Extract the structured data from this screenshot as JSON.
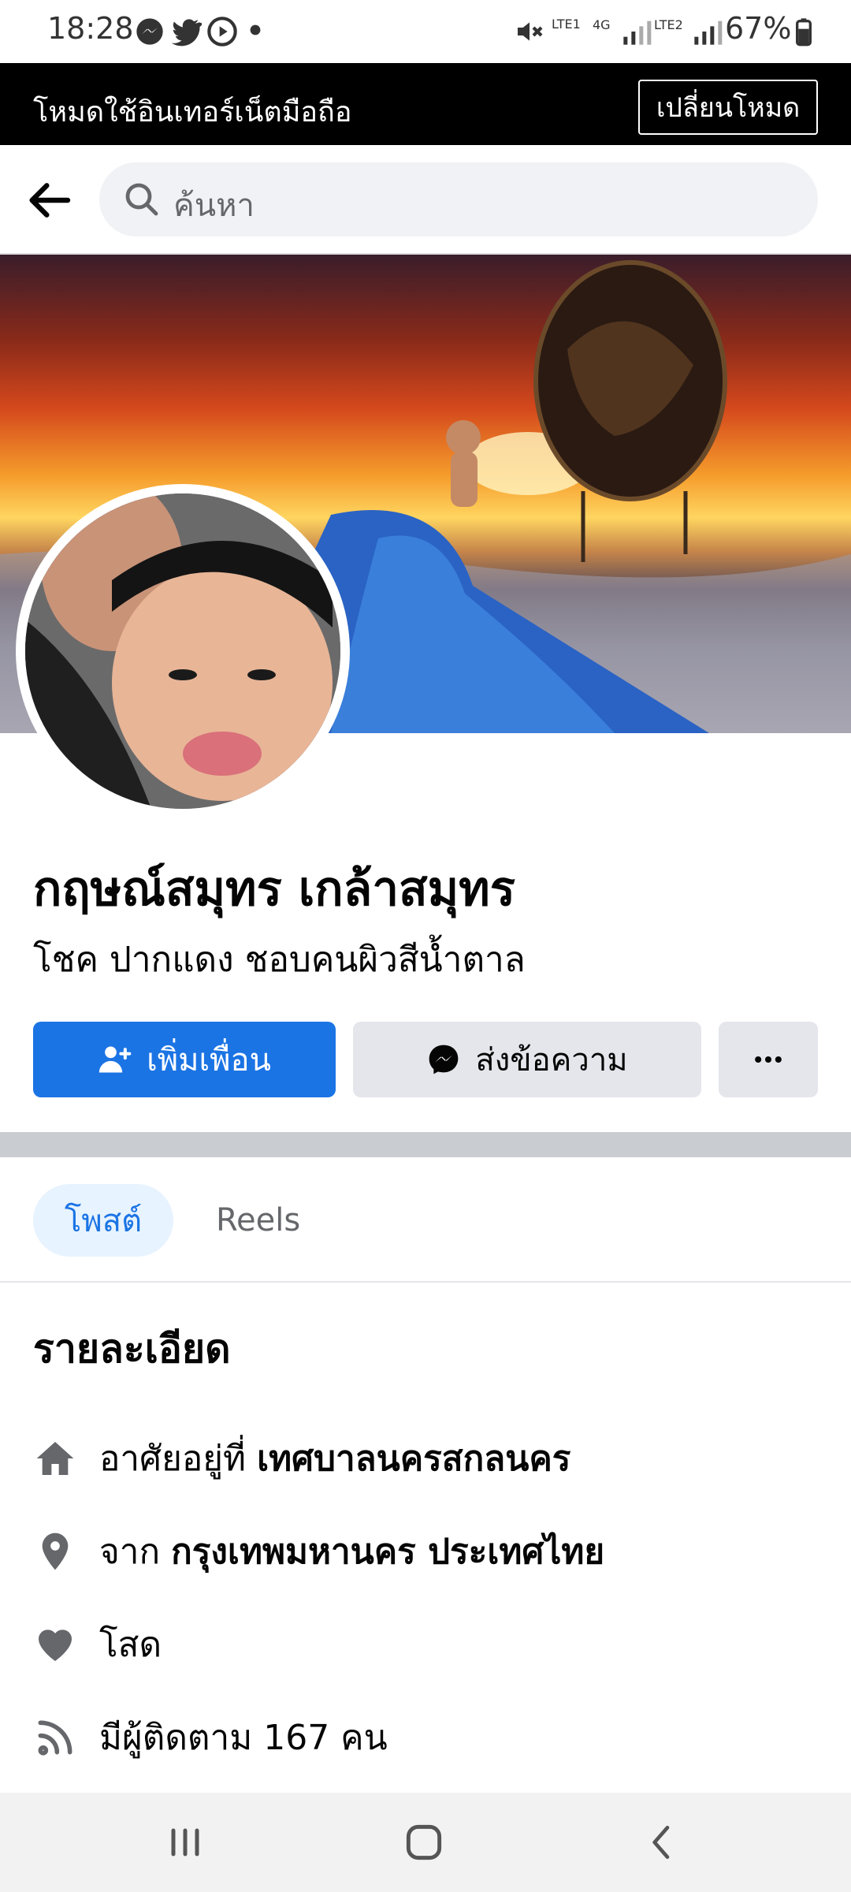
{
  "status_bar": {
    "time": "18:28",
    "battery": "67%",
    "sim1": "LTE1",
    "sim2": "LTE2",
    "network": "4G"
  },
  "mode_banner": {
    "text": "โหมดใช้อินเทอร์เน็ตมือถือ",
    "button": "เปลี่ยนโหมด"
  },
  "search": {
    "placeholder": "ค้นหา"
  },
  "profile": {
    "name": "กฤษณ์สมุทร เกล้าสมุทร",
    "bio": "โชค  ปากแดง ชอบคนผิวสีน้ำตาล"
  },
  "actions": {
    "add_friend": "เพิ่มเพื่อน",
    "message": "ส่งข้อความ"
  },
  "tabs": {
    "posts": "โพสต์",
    "reels": "Reels"
  },
  "details": {
    "title": "รายละเอียด",
    "lives_prefix": "อาศัยอยู่ที่",
    "lives_value": "เทศบาลนครสกลนคร",
    "from_prefix": "จาก",
    "from_value": "กรุงเทพมหานคร ประเทศไทย",
    "relationship": "โสด",
    "followers": "มีผู้ติดตาม 167 คน"
  },
  "colors": {
    "primary": "#1b74e4",
    "button_grey": "#e4e6eb",
    "banner": "#000000"
  }
}
